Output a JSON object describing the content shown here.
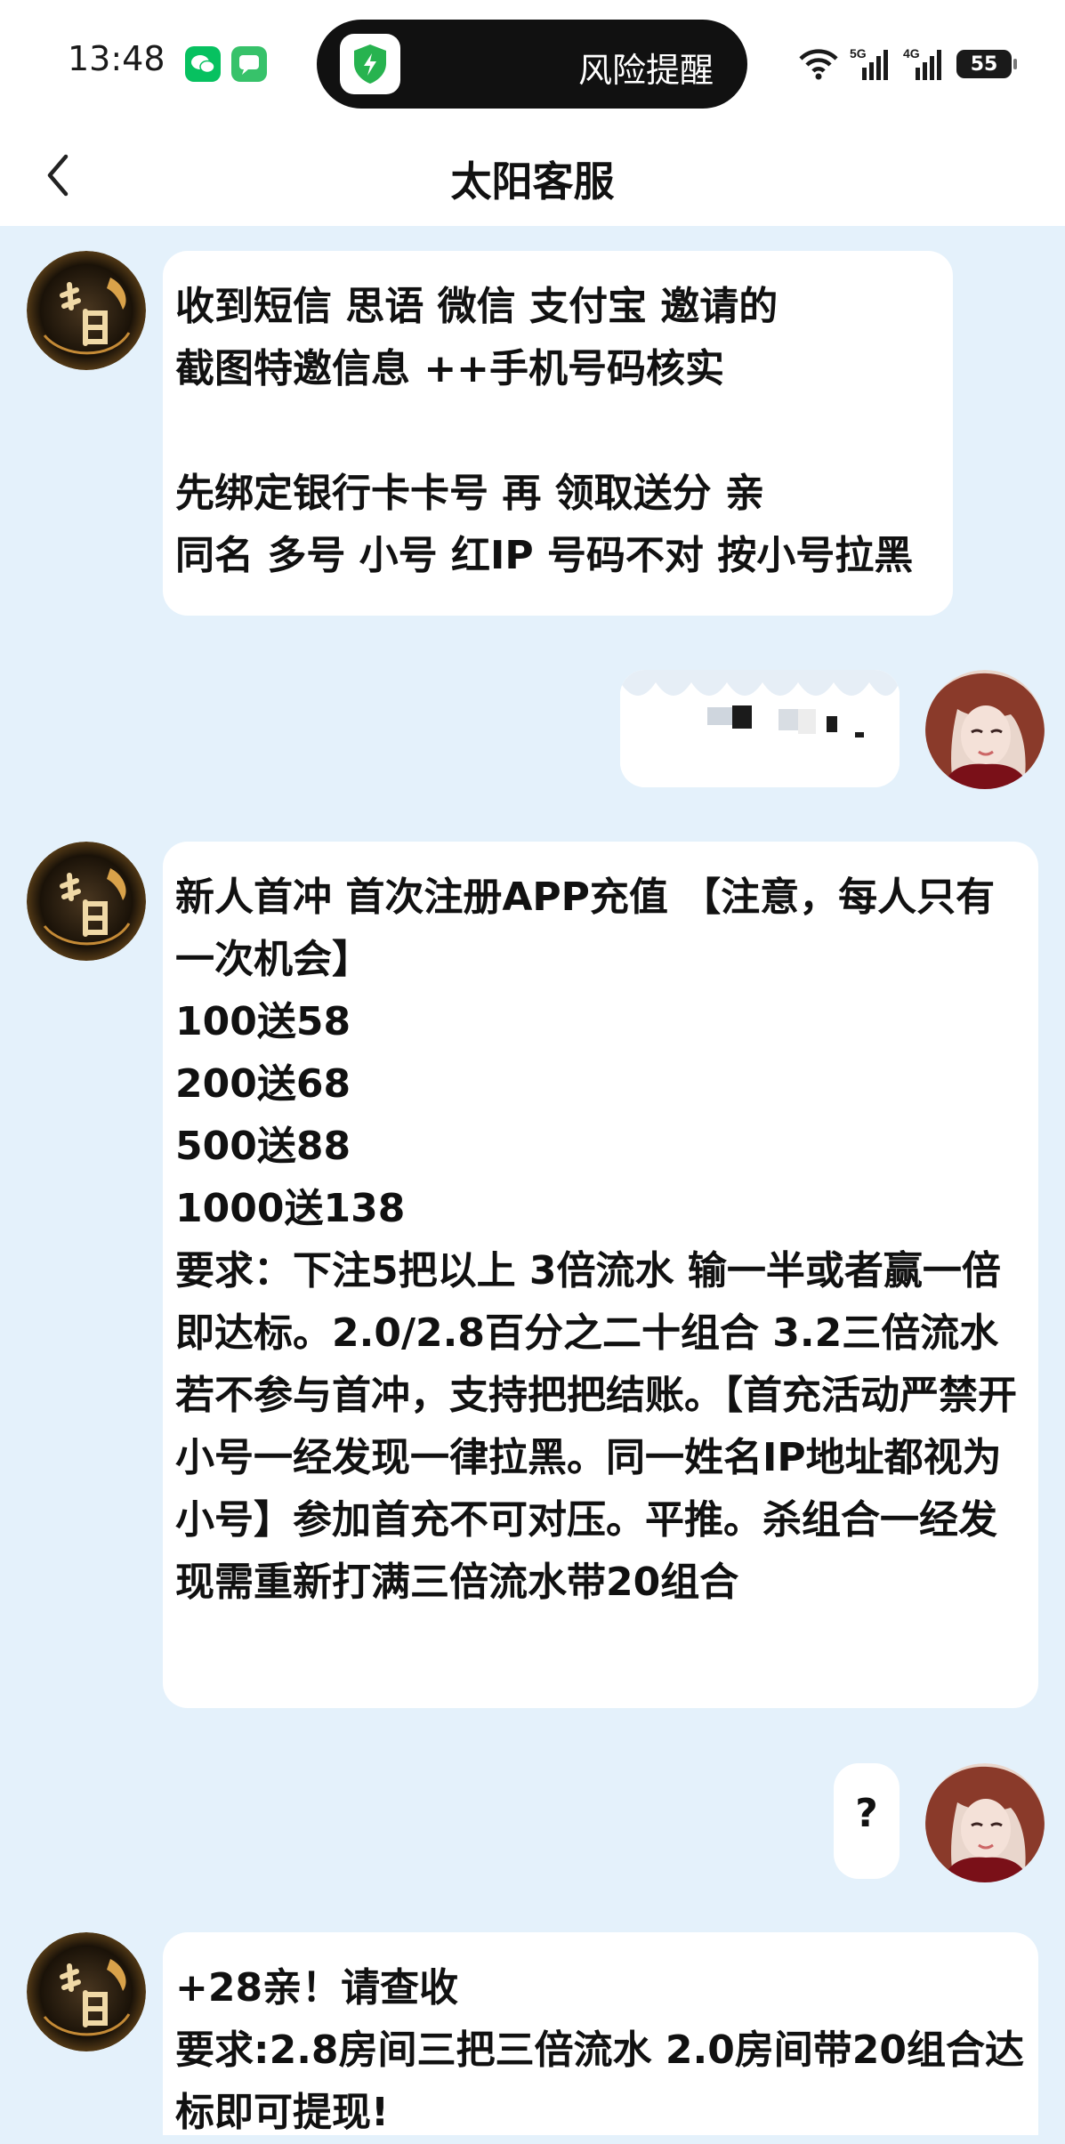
{
  "status_bar": {
    "time": "13:48",
    "alert_text": "风险提醒",
    "network_1": "5G",
    "network_2": "4G",
    "battery": "55"
  },
  "header": {
    "title": "太阳客服"
  },
  "messages": [
    {
      "sender": "agent",
      "text": "收到短信 思语 微信 支付宝 邀请的\n截图特邀信息 ++手机号码核实\n\n先绑定银行卡卡号 再 领取送分 亲\n同名 多号 小号 红IP 号码不对 按小号拉黑"
    },
    {
      "sender": "user",
      "type": "image"
    },
    {
      "sender": "agent",
      "text": "新人首冲 首次注册APP充值 【注意，每人只有一次机会】\n100送58\n200送68\n500送88\n1000送138\n要求：下注5把以上 3倍流水 输一半或者赢一倍即达标。2.0/2.8百分之二十组合 3.2三倍流水\n若不参与首冲，支持把把结账。【首充活动严禁开小号一经发现一律拉黑。同一姓名IP地址都视为小号】参加首充不可对压。平推。杀组合一经发现需重新打满三倍流水带20组合"
    },
    {
      "sender": "user",
      "text": "?"
    },
    {
      "sender": "agent",
      "text": "+28亲！请查收\n要求:2.8房间三把三倍流水 2.0房间带20组合达标即可提现!"
    }
  ],
  "colors": {
    "chat_background": "#e4f1fb",
    "bubble": "#ffffff",
    "status_bar": "#ffffff"
  }
}
